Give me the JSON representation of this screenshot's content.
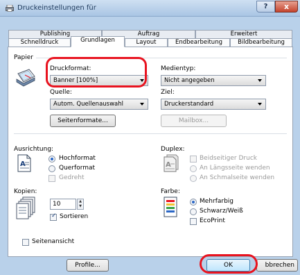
{
  "window": {
    "title": "Druckeinstellungen für",
    "help_label": "?",
    "close_label": "x"
  },
  "tabs_back": [
    {
      "label": "Publishing"
    },
    {
      "label": "Auftrag"
    },
    {
      "label": "Erweitert"
    }
  ],
  "tabs_front": [
    {
      "label": "Schnelldruck"
    },
    {
      "label": "Grundlagen"
    },
    {
      "label": "Layout"
    },
    {
      "label": "Endbearbeitung"
    },
    {
      "label": "Bildbearbeitung"
    }
  ],
  "active_tab": "Grundlagen",
  "paper": {
    "section_label": "Papier",
    "format_label": "Druckformat:",
    "format_value": "Banner [100%]",
    "media_label": "Medientyp:",
    "media_value": "Nicht angegeben",
    "source_label": "Quelle:",
    "source_value": "Autom. Quellenauswahl",
    "target_label": "Ziel:",
    "target_value": "Druckerstandard",
    "page_sizes_button": "Seitenformate...",
    "mailbox_button": "Mailbox..."
  },
  "orientation": {
    "label": "Ausrichtung:",
    "options": [
      "Hochformat",
      "Querformat"
    ],
    "selected": "Hochformat",
    "rotated_label": "Gedreht"
  },
  "duplex": {
    "label": "Duplex:",
    "double_sided_label": "Beidseitiger Druck",
    "options": [
      "An Längsseite wenden",
      "An Schmalseite wenden"
    ]
  },
  "copies": {
    "label": "Kopien:",
    "value": "10",
    "collate_label": "Sortieren",
    "collate_checked": true
  },
  "color": {
    "label": "Farbe:",
    "options": [
      "Mehrfarbig",
      "Schwarz/Weiß"
    ],
    "selected": "Mehrfarbig",
    "ecoprint_label": "EcoPrint"
  },
  "page_view_label": "Seitenansicht",
  "footer": {
    "profiles_button": "Profile...",
    "ok_button": "OK",
    "cancel_button": "bbrechen"
  },
  "colors": {
    "annotation": "#e8131f",
    "accent": "#2b67c6"
  }
}
